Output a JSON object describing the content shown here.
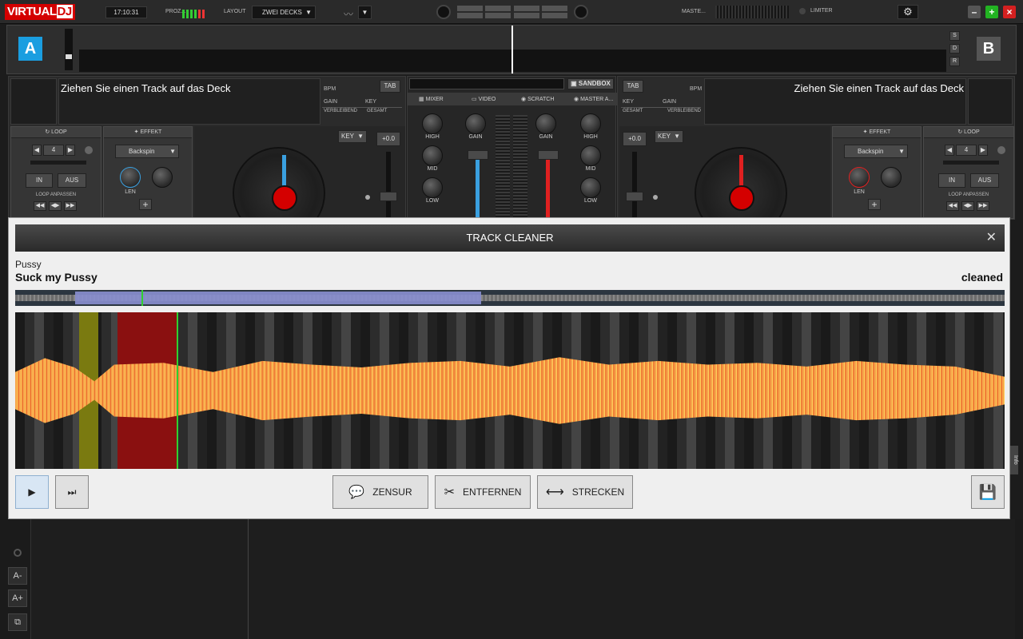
{
  "topbar": {
    "logo_left": "VIRTUAL",
    "logo_right": "DJ",
    "clock": "17:10:31",
    "cpu_label": "PROZ...",
    "layout_label": "LAYOUT",
    "layout_value": "ZWEI DECKS",
    "master_label": "MASTE...",
    "limiter_label": "LIMITER",
    "colors": {
      "logo": "#d40000",
      "minimize": "#555555",
      "maximize": "#22b322",
      "close": "#d42020"
    }
  },
  "deck_strip": {
    "left_letter": "A",
    "right_letter": "B",
    "side_buttons": [
      "S",
      "D",
      "R"
    ]
  },
  "deck_left": {
    "track_prompt": "Ziehen Sie einen Track auf das Deck",
    "bpm_label": "BPM",
    "tab_label": "TAB",
    "gain_label": "GAIN",
    "key_label": "KEY",
    "remaining_label": "VERBLEIBEND",
    "total_label": "GESAMT",
    "loop_title": "LOOP",
    "loop_value": "4",
    "in_label": "IN",
    "out_label": "AUS",
    "loop_adjust_label": "LOOP ANPASSEN",
    "effect_title": "EFFEKT",
    "effect_value": "Backspin",
    "len_label": "LEN",
    "key_button": "KEY",
    "pitch_value": "+0.0",
    "accent": "#3aa0e0"
  },
  "deck_right": {
    "track_prompt": "Ziehen Sie einen Track auf das Deck",
    "bpm_label": "BPM",
    "tab_label": "TAB",
    "gain_label": "GAIN",
    "key_label": "KEY",
    "remaining_label": "VERBLEIBEND",
    "total_label": "GESAMT",
    "loop_title": "LOOP",
    "loop_value": "4",
    "in_label": "IN",
    "out_label": "AUS",
    "loop_adjust_label": "LOOP ANPASSEN",
    "effect_title": "EFFEKT",
    "effect_value": "Backspin",
    "len_label": "LEN",
    "key_button": "KEY",
    "pitch_value": "+0.0",
    "accent": "#e02020"
  },
  "mixer": {
    "sandbox_label": "SANDBOX",
    "tabs": [
      "MIXER",
      "VIDEO",
      "SCRATCH",
      "MASTER A..."
    ],
    "left_knobs": [
      "HIGH",
      "MID",
      "LOW"
    ],
    "right_knobs": [
      "HIGH",
      "MID",
      "LOW"
    ],
    "gain_left": "GAIN",
    "gain_right": "GAIN"
  },
  "modal": {
    "title": "TRACK CLEANER",
    "artist": "Pussy",
    "track_title": "Suck my Pussy",
    "status": "cleaned",
    "buttons": {
      "censor": "ZENSUR",
      "remove": "ENTFERNEN",
      "stretch": "STRECKEN"
    }
  },
  "browser": {
    "info_tab": "Info",
    "side_buttons": [
      "A-",
      "A+"
    ]
  }
}
